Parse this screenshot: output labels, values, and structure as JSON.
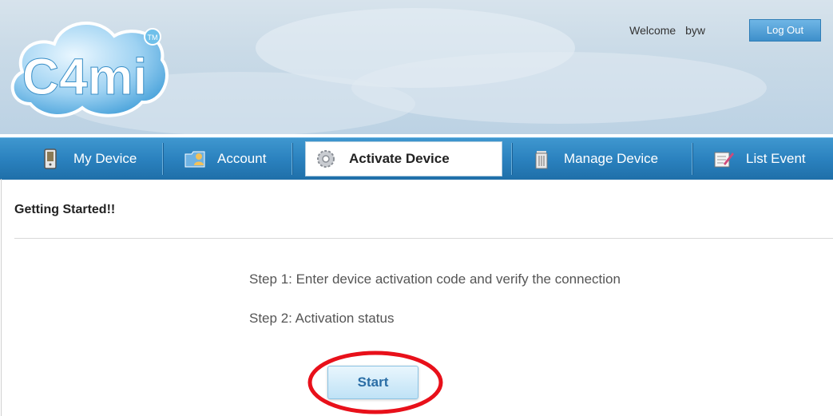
{
  "header": {
    "logo_text": "C4mi",
    "logo_tm": "TM",
    "welcome_label": "Welcome",
    "username": "byw",
    "logout_label": "Log Out"
  },
  "nav": {
    "items": [
      {
        "label": "My Device",
        "icon": "phone-device-icon"
      },
      {
        "label": "Account",
        "icon": "folder-user-icon"
      },
      {
        "label": "Activate Device",
        "icon": "gear-icon",
        "active": true
      },
      {
        "label": "Manage Device",
        "icon": "trash-icon"
      },
      {
        "label": "List Event",
        "icon": "note-pencil-icon"
      }
    ]
  },
  "content": {
    "title": "Getting Started!!",
    "step1": "Step 1: Enter device activation code and verify the connection",
    "step2": "Step 2: Activation status",
    "start_label": "Start"
  },
  "colors": {
    "nav_blue": "#2b82bf",
    "highlight_red": "#e8101a",
    "start_text": "#2a6da5"
  }
}
